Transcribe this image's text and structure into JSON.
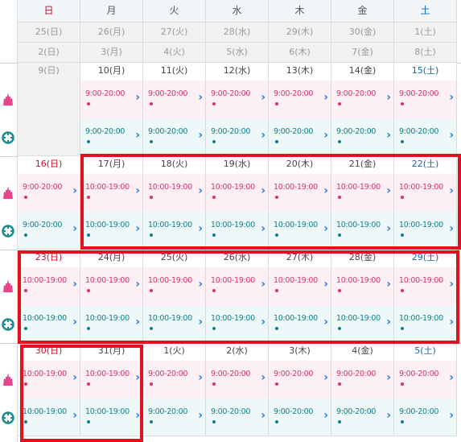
{
  "colors": {
    "sunday": "#c8102e",
    "saturday": "#0a67b5",
    "park_a": "#d6336c",
    "park_b": "#0f7f8a",
    "highlight": "#e0121f"
  },
  "weekdays": [
    "日",
    "月",
    "火",
    "水",
    "木",
    "金",
    "土"
  ],
  "parks": [
    {
      "icon": "castle-icon"
    },
    {
      "icon": "globe-icon"
    }
  ],
  "past_rows": [
    [
      "25(日)",
      "26(月)",
      "27(火)",
      "28(水)",
      "29(木)",
      "30(金)",
      "1(土)"
    ],
    [
      "2(日)",
      "3(月)",
      "4(火)",
      "5(水)",
      "6(木)",
      "7(金)",
      "8(土)"
    ]
  ],
  "weeks": [
    {
      "days": [
        {
          "label": "9(日)",
          "disabled": true
        },
        {
          "label": "10(月)",
          "p": "9:00-20:00",
          "t": "9:00-20:00"
        },
        {
          "label": "11(火)",
          "p": "9:00-20:00",
          "t": "9:00-20:00"
        },
        {
          "label": "12(水)",
          "p": "9:00-20:00",
          "t": "9:00-20:00"
        },
        {
          "label": "13(木)",
          "p": "9:00-20:00",
          "t": "9:00-20:00"
        },
        {
          "label": "14(金)",
          "p": "9:00-20:00",
          "t": "9:00-20:00"
        },
        {
          "label": "15(土)",
          "p": "9:00-20:00",
          "t": "9:00-20:00"
        }
      ]
    },
    {
      "days": [
        {
          "label": "16(日)",
          "p": "9:00-20:00",
          "t": "9:00-20:00"
        },
        {
          "label": "17(月)",
          "p": "10:00-19:00",
          "t": "10:00-19:00"
        },
        {
          "label": "18(火)",
          "p": "10:00-19:00",
          "t": "10:00-19:00"
        },
        {
          "label": "19(水)",
          "p": "10:00-19:00",
          "t": "10:00-19:00"
        },
        {
          "label": "20(木)",
          "p": "10:00-19:00",
          "t": "10:00-19:00"
        },
        {
          "label": "21(金)",
          "p": "10:00-19:00",
          "t": "10:00-19:00"
        },
        {
          "label": "22(土)",
          "p": "10:00-19:00",
          "t": "10:00-19:00"
        }
      ]
    },
    {
      "days": [
        {
          "label": "23(日)",
          "p": "10:00-19:00",
          "t": "10:00-19:00"
        },
        {
          "label": "24(月)",
          "p": "10:00-19:00",
          "t": "10:00-19:00"
        },
        {
          "label": "25(火)",
          "p": "10:00-19:00",
          "t": "10:00-19:00"
        },
        {
          "label": "26(水)",
          "p": "10:00-19:00",
          "t": "10:00-19:00"
        },
        {
          "label": "27(木)",
          "p": "10:00-19:00",
          "t": "10:00-19:00"
        },
        {
          "label": "28(金)",
          "p": "10:00-19:00",
          "t": "10:00-19:00"
        },
        {
          "label": "29(土)",
          "p": "10:00-19:00",
          "t": "10:00-19:00"
        }
      ]
    },
    {
      "days": [
        {
          "label": "30(日)",
          "p": "10:00-19:00",
          "t": "10:00-19:00"
        },
        {
          "label": "31(月)",
          "p": "10:00-19:00",
          "t": "10:00-19:00"
        },
        {
          "label": "1(火)",
          "p": "9:00-20:00",
          "t": "9:00-20:00"
        },
        {
          "label": "2(水)",
          "p": "9:00-20:00",
          "t": "9:00-20:00"
        },
        {
          "label": "3(木)",
          "p": "9:00-20:00",
          "t": "9:00-20:00"
        },
        {
          "label": "4(金)",
          "p": "9:00-20:00",
          "t": "9:00-20:00"
        },
        {
          "label": "5(土)",
          "p": "9:00-20:00",
          "t": "9:00-20:00"
        }
      ]
    }
  ]
}
